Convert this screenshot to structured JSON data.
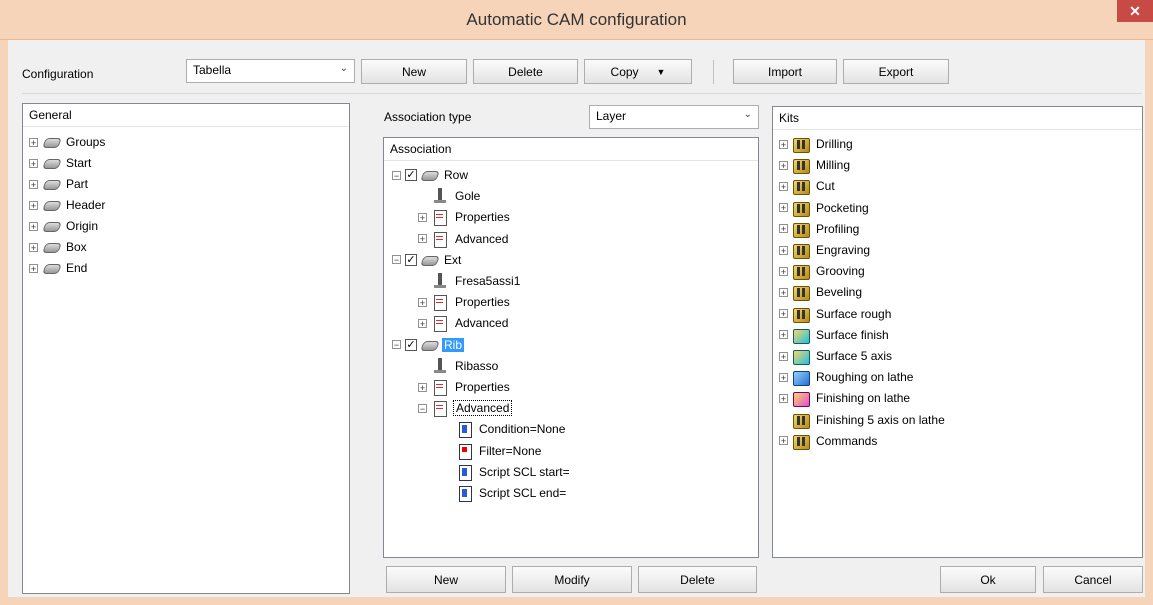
{
  "window": {
    "title": "Automatic CAM configuration",
    "close_glyph": "✕"
  },
  "toolbar": {
    "configuration_label": "Configuration",
    "configuration_value": "Tabella",
    "new_label": "New",
    "delete_label": "Delete",
    "copy_label": "Copy",
    "import_label": "Import",
    "export_label": "Export"
  },
  "general": {
    "header": "General",
    "items": [
      {
        "label": "Groups",
        "icon": "layer-icon"
      },
      {
        "label": "Start",
        "icon": "layer-icon"
      },
      {
        "label": "Part",
        "icon": "layer-icon"
      },
      {
        "label": "Header",
        "icon": "layer-icon"
      },
      {
        "label": "Origin",
        "icon": "layer-icon"
      },
      {
        "label": "Box",
        "icon": "layer-icon"
      },
      {
        "label": "End",
        "icon": "layer-icon"
      }
    ]
  },
  "association": {
    "type_label": "Association type",
    "type_value": "Layer",
    "header": "Association",
    "tree": [
      {
        "label": "Row",
        "level": 0,
        "checked": true,
        "expanded": true,
        "icon": "layer-icon"
      },
      {
        "label": "Gole",
        "level": 1,
        "icon": "tool-icon"
      },
      {
        "label": "Properties",
        "level": 1,
        "expandable": true,
        "icon": "document-icon"
      },
      {
        "label": "Advanced",
        "level": 1,
        "expandable": true,
        "icon": "document-icon"
      },
      {
        "label": "Ext",
        "level": 0,
        "checked": true,
        "expanded": true,
        "icon": "layer-icon"
      },
      {
        "label": "Fresa5assi1",
        "level": 1,
        "icon": "tool-icon"
      },
      {
        "label": "Properties",
        "level": 1,
        "expandable": true,
        "icon": "document-icon"
      },
      {
        "label": "Advanced",
        "level": 1,
        "expandable": true,
        "icon": "document-icon"
      },
      {
        "label": "Rib",
        "level": 0,
        "checked": true,
        "expanded": true,
        "selected": true,
        "icon": "layer-icon"
      },
      {
        "label": "Ribasso",
        "level": 1,
        "icon": "tool-icon"
      },
      {
        "label": "Properties",
        "level": 1,
        "expandable": true,
        "icon": "document-icon"
      },
      {
        "label": "Advanced",
        "level": 1,
        "expandable": true,
        "expanded": true,
        "focused": true,
        "icon": "document-icon"
      },
      {
        "label": "Condition=None",
        "level": 2,
        "icon": "condition-icon"
      },
      {
        "label": "Filter=None",
        "level": 2,
        "icon": "filter-icon"
      },
      {
        "label": "Script SCL start=",
        "level": 2,
        "icon": "script-icon"
      },
      {
        "label": "Script SCL end=",
        "level": 2,
        "icon": "script-icon"
      }
    ],
    "new_label": "New",
    "modify_label": "Modify",
    "delete_label": "Delete"
  },
  "kits": {
    "header": "Kits",
    "items": [
      {
        "label": "Drilling",
        "expandable": true,
        "icon": "drilling-icon"
      },
      {
        "label": "Milling",
        "expandable": true,
        "icon": "milling-icon"
      },
      {
        "label": "Cut",
        "expandable": true,
        "icon": "cut-icon"
      },
      {
        "label": "Pocketing",
        "expandable": true,
        "icon": "pocketing-icon"
      },
      {
        "label": "Profiling",
        "expandable": true,
        "icon": "profiling-icon"
      },
      {
        "label": "Engraving",
        "expandable": true,
        "icon": "engraving-icon"
      },
      {
        "label": "Grooving",
        "expandable": true,
        "icon": "grooving-icon"
      },
      {
        "label": "Beveling",
        "expandable": true,
        "icon": "beveling-icon"
      },
      {
        "label": "Surface rough",
        "expandable": true,
        "icon": "surface-rough-icon"
      },
      {
        "label": "Surface finish",
        "expandable": true,
        "icon": "surface-finish-icon"
      },
      {
        "label": "Surface 5 axis",
        "expandable": true,
        "icon": "surface-5-axis-icon"
      },
      {
        "label": "Roughing on lathe",
        "expandable": true,
        "icon": "roughing-lathe-icon"
      },
      {
        "label": "Finishing on lathe",
        "expandable": true,
        "icon": "finishing-lathe-icon"
      },
      {
        "label": "Finishing 5 axis on lathe",
        "expandable": false,
        "icon": "finishing-5-axis-lathe-icon"
      },
      {
        "label": "Commands",
        "expandable": true,
        "icon": "commands-icon"
      }
    ]
  },
  "footer": {
    "ok_label": "Ok",
    "cancel_label": "Cancel"
  }
}
